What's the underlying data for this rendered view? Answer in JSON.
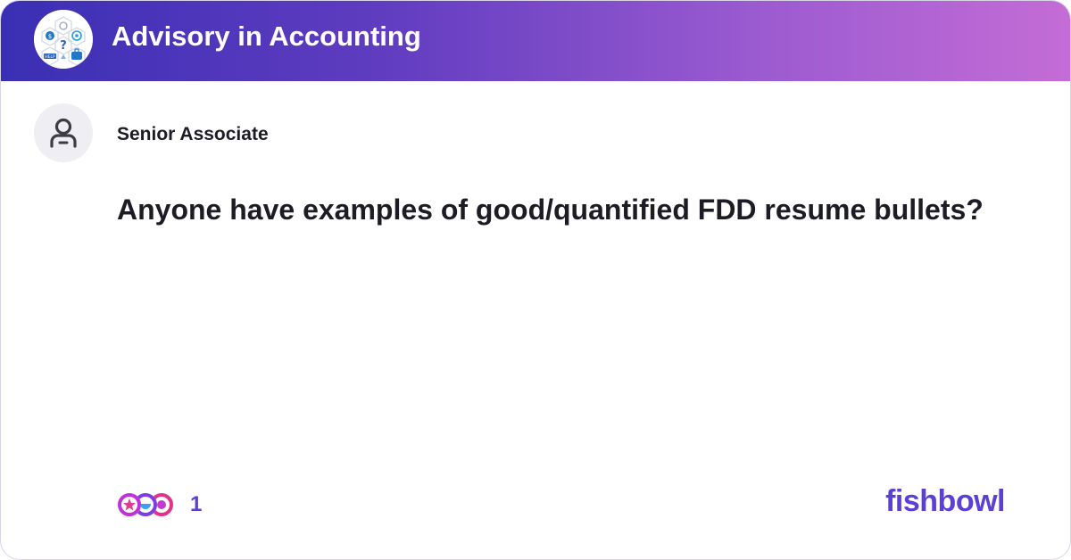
{
  "header": {
    "bowl_name": "Advisory in Accounting",
    "bowl_icon": "help-hexagons-icon",
    "gradient_colors": [
      "#3a2fb4",
      "#5f3cc0",
      "#9a5ad0",
      "#c46cd6"
    ]
  },
  "post": {
    "author_title": "Senior Associate",
    "author_icon": "user-icon",
    "title": "Anyone have examples of good/quantified FDD resume bullets?"
  },
  "footer": {
    "reaction_count": "1",
    "reaction_icons": [
      "star-reaction-icon",
      "laugh-reaction-icon",
      "celebrate-reaction-icon"
    ],
    "brand": "fishbowl",
    "brand_color": "#5b3fd6"
  }
}
